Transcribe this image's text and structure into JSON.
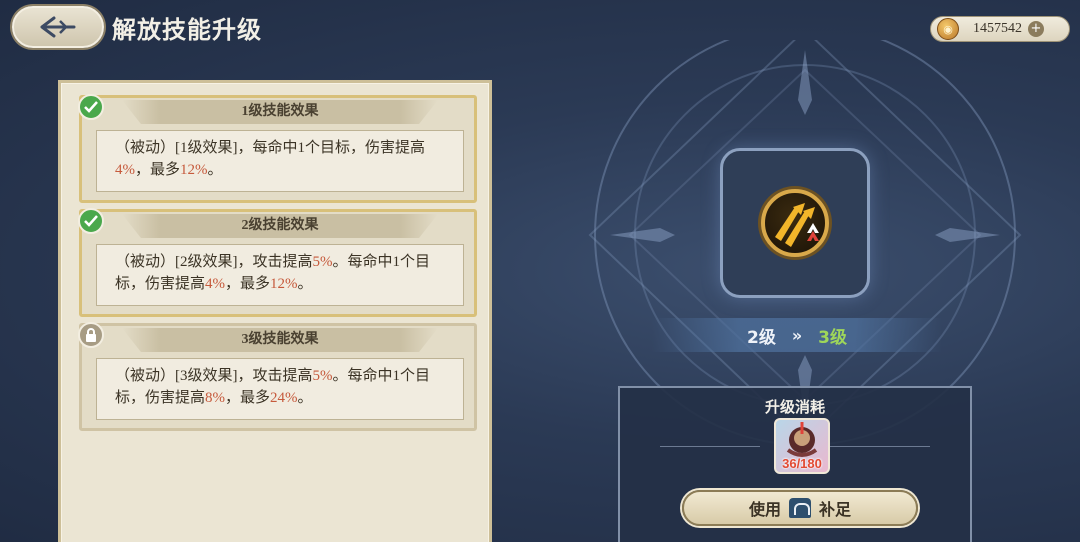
{
  "header": {
    "title": "解放技能升级",
    "back_icon": "back-arrow-icon",
    "currency": {
      "icon": "coin-icon",
      "value": "1457542",
      "add_icon": "plus-icon"
    }
  },
  "levels": [
    {
      "title": "1级技能效果",
      "status": "unlocked",
      "text_parts": [
        "（被动）[1级效果]，每命中1个目标，伤害提高",
        "4%",
        "，最多",
        "12%",
        "。"
      ]
    },
    {
      "title": "2级技能效果",
      "status": "unlocked",
      "text_parts": [
        "（被动）[2级效果]，攻击提高",
        "5%",
        "。每命中1个目标，伤害提高",
        "4%",
        "，最多",
        "12%",
        "。"
      ]
    },
    {
      "title": "3级技能效果",
      "status": "locked",
      "text_parts": [
        "（被动）[3级效果]，攻击提高",
        "5%",
        "。每命中1个目标，伤害提高",
        "8%",
        "，最多",
        "24%",
        "。"
      ]
    }
  ],
  "upgrade": {
    "from_level": "2级",
    "to_level": "3级",
    "arrow": "»"
  },
  "cost": {
    "title": "升级消耗",
    "item_count": "36/180",
    "button": {
      "label_before": "使用",
      "label_after": "补足",
      "icon": "shop-bag-icon"
    }
  },
  "colors": {
    "highlight": "#c65a3c",
    "next_level": "#9ed65a",
    "done_badge": "#4aa84c"
  }
}
